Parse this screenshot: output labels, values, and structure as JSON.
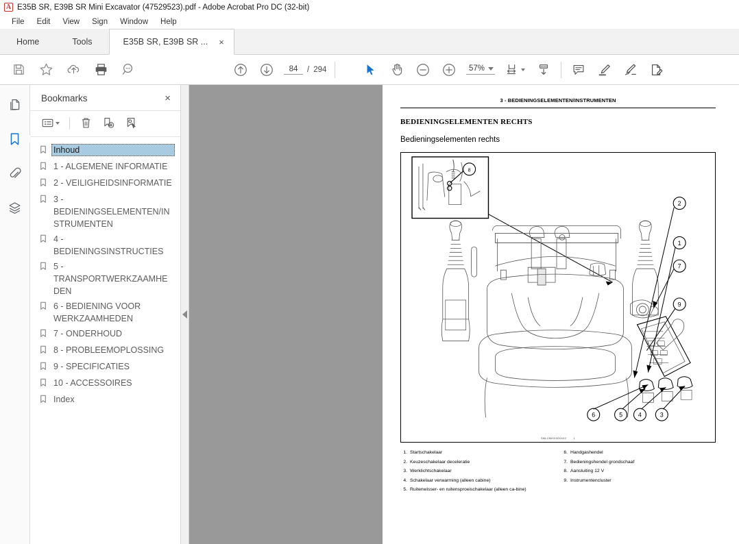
{
  "window": {
    "title": "E35B SR, E39B SR Mini Excavator (47529523).pdf - Adobe Acrobat Pro DC (32-bit)",
    "app_icon": "acrobat-logo-icon"
  },
  "menubar": {
    "items": [
      {
        "label": "File"
      },
      {
        "label": "Edit"
      },
      {
        "label": "View"
      },
      {
        "label": "Sign"
      },
      {
        "label": "Window"
      },
      {
        "label": "Help"
      }
    ]
  },
  "tabs": {
    "home_label": "Home",
    "tools_label": "Tools",
    "document_label": "E35B SR, E39B SR ...",
    "close_glyph": "×"
  },
  "toolbar": {
    "left_tools": [
      {
        "name": "save-icon"
      },
      {
        "name": "star-icon"
      },
      {
        "name": "upload-cloud-icon"
      },
      {
        "name": "print-icon"
      },
      {
        "name": "search-icon"
      }
    ],
    "page_up_icon": "arrow-up-circle-icon",
    "page_down_icon": "arrow-down-circle-icon",
    "page_current": "84",
    "page_separator": "/",
    "page_total": "294",
    "select_icon": "cursor-select-icon",
    "hand_icon": "hand-tool-icon",
    "zoom_out_icon": "zoom-out-icon",
    "zoom_in_icon": "zoom-in-icon",
    "zoom_level": "57%",
    "fit_page_icon": "fit-page-icon",
    "scroll_mode_icon": "scroll-mode-icon",
    "comment_icon": "comment-icon",
    "highlight_icon": "highlight-icon",
    "sign_icon": "sign-icon",
    "edit_pdf_icon": "edit-pdf-icon"
  },
  "rail": {
    "items": [
      {
        "name": "page-thumbnails-icon",
        "active": false
      },
      {
        "name": "bookmarks-icon",
        "active": true
      },
      {
        "name": "attachments-icon",
        "active": false
      },
      {
        "name": "layers-icon",
        "active": false
      }
    ],
    "active_color": "#1473cc"
  },
  "bookmarks": {
    "panel_title": "Bookmarks",
    "close_glyph": "×",
    "tools": [
      {
        "name": "bookmark-options-icon"
      },
      {
        "name": "delete-bookmark-icon"
      },
      {
        "name": "new-bookmark-icon"
      },
      {
        "name": "set-bookmark-destination-icon"
      }
    ],
    "selection_color": "#a8cbe2",
    "items": [
      {
        "label": "Inhoud",
        "selected": true
      },
      {
        "label": "1 - ALGEMENE INFORMATIE",
        "selected": false
      },
      {
        "label": "2 - VEILIGHEIDSINFORMATIE",
        "selected": false
      },
      {
        "label": "3 - BEDIENINGSELEMENTEN/INSTRUMENTEN",
        "selected": false
      },
      {
        "label": "4 - BEDIENINGSINSTRUCTIES",
        "selected": false
      },
      {
        "label": "5 - TRANSPORTWERKZAAMHEDEN",
        "selected": false
      },
      {
        "label": "6 - BEDIENING VOOR WERKZAAMHEDEN",
        "selected": false
      },
      {
        "label": "7 - ONDERHOUD",
        "selected": false
      },
      {
        "label": "8 - PROBLEEMOPLOSSING",
        "selected": false
      },
      {
        "label": "9 - SPECIFICATIES",
        "selected": false
      },
      {
        "label": "10 - ACCESSOIRES",
        "selected": false
      },
      {
        "label": "Index",
        "selected": false
      }
    ]
  },
  "document": {
    "running_head": "3 - BEDIENINGSELEMENTEN/INSTRUMENTEN",
    "heading": "BEDIENINGSELEMENTEN RECHTS",
    "subheading": "Bedieningselementen rechts",
    "figure_code": "SML13MXXXD04XC",
    "figure_number": "1",
    "callouts": [
      "1",
      "2",
      "3",
      "4",
      "5",
      "6",
      "7",
      "8",
      "9"
    ],
    "legend_left": [
      {
        "num": "1.",
        "text": "Startschakelaar"
      },
      {
        "num": "2.",
        "text": "Keuzeschakelaar deceleratie"
      },
      {
        "num": "3.",
        "text": "Werklichtschakelaar"
      },
      {
        "num": "4.",
        "text": "Schakelaar verwarming (alleen cabine)"
      },
      {
        "num": "5.",
        "text": "Ruitenwisser- en ruitensproeischakelaar (alleen ca-bine)"
      }
    ],
    "legend_right": [
      {
        "num": "6.",
        "text": "Handgashendel"
      },
      {
        "num": "7.",
        "text": "Bedieningshendel grondschaaf"
      },
      {
        "num": "8.",
        "text": "Aansluiting 12 V"
      },
      {
        "num": "9.",
        "text": "Instrumentencluster"
      }
    ]
  }
}
